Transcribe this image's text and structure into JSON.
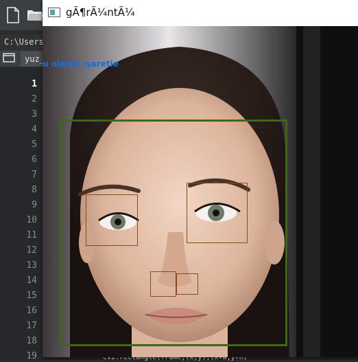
{
  "editor": {
    "path_text": "C:\\Users\\",
    "tab_label": "yuz_",
    "line_numbers": [
      "1",
      "2",
      "3",
      "4",
      "5",
      "6",
      "7",
      "8",
      "9",
      "10",
      "11",
      "12",
      "13",
      "14",
      "15",
      "16",
      "17",
      "18",
      "19"
    ],
    "active_line": "1",
    "bottom_text": "cv2.rectangle(frame,(x,y),(x+w,y+h)"
  },
  "window": {
    "title": "gÃ¶rÃ¼ntÃ¼",
    "overlay_label": "u olarak işaretle"
  },
  "detections": {
    "face": "face",
    "left_eye": "left eye",
    "right_eye": "right eye",
    "left_nostril": "nostril",
    "right_nostril": "nostril"
  },
  "colors": {
    "face_box": "#3a6b14",
    "feature_box": "#8a4a18",
    "overlay_text": "#1b6fd6"
  },
  "icons": [
    "new-file-icon",
    "open-folder-icon",
    "folder-icon",
    "window-app-icon"
  ]
}
